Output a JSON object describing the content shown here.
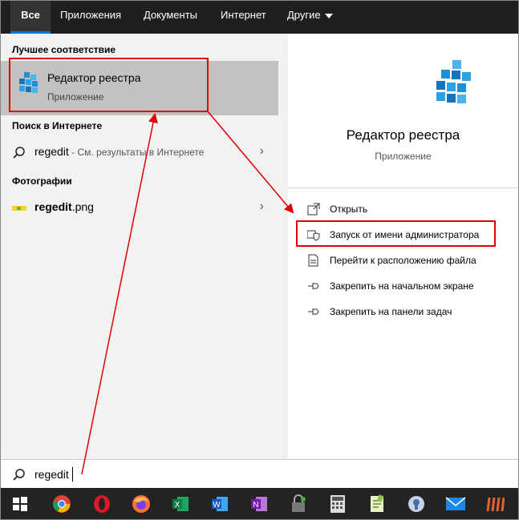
{
  "tabs": [
    {
      "label": "Все",
      "active": true
    },
    {
      "label": "Приложения"
    },
    {
      "label": "Документы"
    },
    {
      "label": "Интернет"
    },
    {
      "label": "Другие"
    }
  ],
  "best_match": {
    "section": "Лучшее соответствие",
    "title": "Редактор реестра",
    "subtitle": "Приложение"
  },
  "web": {
    "section": "Поиск в Интернете",
    "query": "regedit",
    "hint": " - См. результаты в Интернете"
  },
  "photos": {
    "section": "Фотографии",
    "file_base": "regedit",
    "file_ext": ".png"
  },
  "preview": {
    "app_name": "Редактор реестра",
    "app_type": "Приложение",
    "actions": [
      {
        "label": "Открыть",
        "icon": "open-icon"
      },
      {
        "label": "Запуск от имени администратора",
        "icon": "shield-icon"
      },
      {
        "label": "Перейти к расположению файла",
        "icon": "file-location-icon"
      },
      {
        "label": "Закрепить на начальном экране",
        "icon": "pin-icon"
      },
      {
        "label": "Закрепить на панели задач",
        "icon": "pin-icon"
      }
    ]
  },
  "search": {
    "value": "regedit"
  },
  "taskbar": [
    "windows-icon",
    "chrome-icon",
    "opera-icon",
    "firefox-icon",
    "excel-icon",
    "word-icon",
    "onenote-icon",
    "vpn-icon",
    "calculator-icon",
    "notepad-icon",
    "keepass-icon",
    "mail-icon",
    "app-icon"
  ],
  "colors": {
    "accent": "#0078d7",
    "annotation": "#e00000",
    "selected": "#c2c2c2"
  }
}
